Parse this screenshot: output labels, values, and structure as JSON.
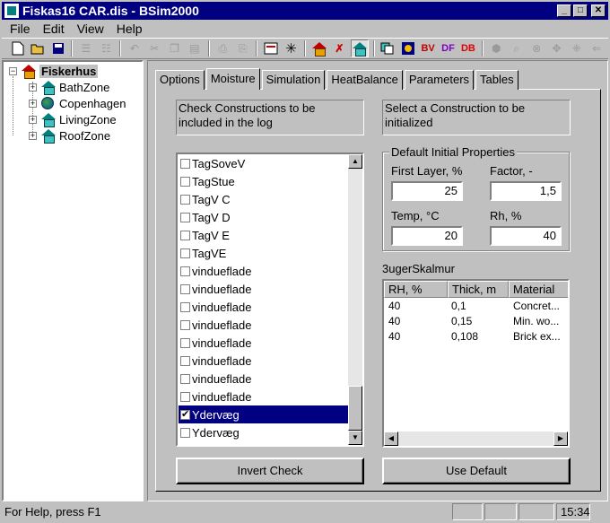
{
  "window": {
    "title": "Fiskas16 CAR.dis - BSim2000",
    "minimize_glyph": "_",
    "maximize_glyph": "□",
    "close_glyph": "✕"
  },
  "menu": {
    "file": "File",
    "edit": "Edit",
    "view": "View",
    "help": "Help"
  },
  "toolbar": {
    "icons": [
      "new-icon",
      "open-icon",
      "save-icon",
      "align-left-icon",
      "align-right-icon",
      "undo-icon",
      "cut-icon",
      "copy-icon",
      "paste-icon",
      "print-preview-icon",
      "print-icon",
      "report-icon",
      "explode-icon",
      "house-icon",
      "house-edit-icon",
      "house-active-icon",
      "copy-object-icon",
      "sun-icon",
      "bv-icon",
      "df-icon",
      "db-icon",
      "solid-icon",
      "zoom-icon",
      "zoom-fit-icon",
      "pan-icon",
      "rotate-icon",
      "back-arrow-icon"
    ],
    "bv_label": "BV",
    "df_label": "DF",
    "db_label": "DB"
  },
  "tree": {
    "root": "Fiskerhus",
    "expand_glyph": "−",
    "collapse_glyph": "+",
    "children": [
      "BathZone",
      "Copenhagen",
      "LivingZone",
      "RoofZone"
    ]
  },
  "tabs": [
    "Options",
    "Moisture",
    "Simulation",
    "HeatBalance",
    "Parameters",
    "Tables"
  ],
  "active_tab": "Moisture",
  "moisture": {
    "left_info": "Check Constructions to be included in the log",
    "right_info": "Select a Construction to be initialized",
    "constructions": [
      {
        "name": "TagSoveV",
        "checked": false,
        "selected": false
      },
      {
        "name": "TagStue",
        "checked": false,
        "selected": false
      },
      {
        "name": "TagV C",
        "checked": false,
        "selected": false
      },
      {
        "name": "TagV D",
        "checked": false,
        "selected": false
      },
      {
        "name": "TagV E",
        "checked": false,
        "selected": false
      },
      {
        "name": "TagVE",
        "checked": false,
        "selected": false
      },
      {
        "name": "vinduefladе",
        "checked": false,
        "selected": false
      },
      {
        "name": "vinduefladе",
        "checked": false,
        "selected": false
      },
      {
        "name": "vinduefladе",
        "checked": false,
        "selected": false
      },
      {
        "name": "vinduefladе",
        "checked": false,
        "selected": false
      },
      {
        "name": "vinduefladе",
        "checked": false,
        "selected": false
      },
      {
        "name": "vinduefladе",
        "checked": false,
        "selected": false
      },
      {
        "name": "vinduefladе",
        "checked": false,
        "selected": false
      },
      {
        "name": "vinduefladе",
        "checked": false,
        "selected": false
      },
      {
        "name": "Ydervæg",
        "checked": true,
        "selected": true
      },
      {
        "name": "Ydervæg",
        "checked": false,
        "selected": false
      }
    ],
    "group_title": "Default Initial Properties",
    "first_layer_label": "First Layer, %",
    "first_layer_value": "25",
    "factor_label": "Factor, -",
    "factor_value": "1,5",
    "temp_label": "Temp, °C",
    "temp_value": "20",
    "rh_label": "Rh, %",
    "rh_value": "40",
    "construction_name": "3ugerSkalmur",
    "layers_headers": [
      "RH, %",
      "Thick, m",
      "Material"
    ],
    "layers": [
      [
        "40",
        "0,1",
        "Concret..."
      ],
      [
        "40",
        "0,15",
        "Min. wo..."
      ],
      [
        "40",
        "0,108",
        "Brick ex..."
      ]
    ],
    "invert_button": "Invert Check",
    "default_button": "Use Default"
  },
  "status": {
    "help": "For Help, press F1",
    "time": "15:34"
  },
  "scroll": {
    "up": "▲",
    "down": "▼",
    "left": "◀",
    "right": "▶"
  }
}
